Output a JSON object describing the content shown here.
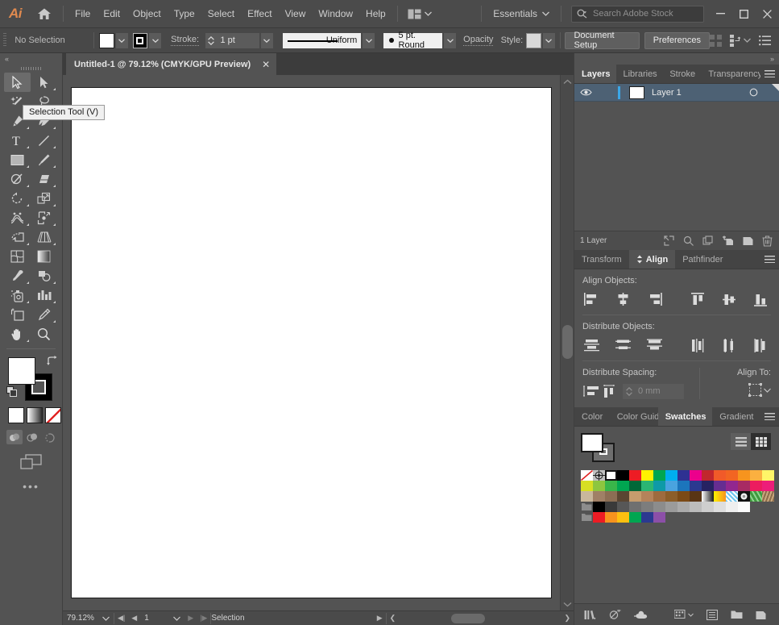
{
  "app": {
    "name": "Adobe Illustrator",
    "logo_text": "Ai"
  },
  "menubar": {
    "home_icon": "home-icon",
    "items": [
      "File",
      "Edit",
      "Object",
      "Type",
      "Select",
      "Effect",
      "View",
      "Window",
      "Help"
    ],
    "arrange_icon": "arrange-documents-icon",
    "workspace": "Essentials",
    "search": {
      "placeholder": "Search Adobe Stock",
      "value": "",
      "icon": "search-icon"
    },
    "window_controls": {
      "minimize": "—",
      "maximize": "❑",
      "close": "✕"
    }
  },
  "controlbar": {
    "selection_status": "No Selection",
    "fill_label": "fill-swatch",
    "stroke_swatch_label": "stroke-swatch",
    "stroke_label": "Stroke:",
    "stroke_weight": "1 pt",
    "stroke_profile": "Uniform",
    "brush": "5 pt. Round",
    "opacity_label": "Opacity",
    "style_label": "Style:",
    "document_setup": "Document Setup",
    "preferences": "Preferences"
  },
  "toolbar": {
    "collapse_icon": "collapse-panel-icon",
    "tools": [
      {
        "name": "selection-tool",
        "active": true,
        "flyout": false
      },
      {
        "name": "direct-selection-tool",
        "active": false,
        "flyout": true
      },
      {
        "name": "magic-wand-tool",
        "active": false,
        "flyout": true
      },
      {
        "name": "lasso-tool",
        "active": false,
        "flyout": false
      },
      {
        "name": "pen-tool",
        "active": false,
        "flyout": true
      },
      {
        "name": "curvature-tool",
        "active": false,
        "flyout": true
      },
      {
        "name": "type-tool",
        "active": false,
        "flyout": true
      },
      {
        "name": "line-segment-tool",
        "active": false,
        "flyout": true
      },
      {
        "name": "rectangle-tool",
        "active": false,
        "flyout": true
      },
      {
        "name": "paintbrush-tool",
        "active": false,
        "flyout": true
      },
      {
        "name": "shaper-tool",
        "active": false,
        "flyout": true
      },
      {
        "name": "eraser-tool",
        "active": false,
        "flyout": true
      },
      {
        "name": "rotate-tool",
        "active": false,
        "flyout": true
      },
      {
        "name": "scale-tool",
        "active": false,
        "flyout": true
      },
      {
        "name": "width-tool",
        "active": false,
        "flyout": true
      },
      {
        "name": "free-transform-tool",
        "active": false,
        "flyout": true
      },
      {
        "name": "shape-builder-tool",
        "active": false,
        "flyout": true
      },
      {
        "name": "perspective-grid-tool",
        "active": false,
        "flyout": true
      },
      {
        "name": "mesh-tool",
        "active": false,
        "flyout": false
      },
      {
        "name": "gradient-tool",
        "active": false,
        "flyout": false
      },
      {
        "name": "eyedropper-tool",
        "active": false,
        "flyout": true
      },
      {
        "name": "blend-tool",
        "active": false,
        "flyout": true
      },
      {
        "name": "symbol-sprayer-tool",
        "active": false,
        "flyout": true
      },
      {
        "name": "column-graph-tool",
        "active": false,
        "flyout": true
      },
      {
        "name": "artboard-tool",
        "active": false,
        "flyout": false
      },
      {
        "name": "slice-tool",
        "active": false,
        "flyout": true
      },
      {
        "name": "hand-tool",
        "active": false,
        "flyout": true
      },
      {
        "name": "zoom-tool",
        "active": false,
        "flyout": false
      }
    ],
    "fill_color": "#ffffff",
    "stroke_color": "#000000",
    "swap_icon": "swap-fill-stroke-icon",
    "default_icon": "default-fill-stroke-icon",
    "color_modes": [
      "color-mode-icon",
      "gradient-mode-icon",
      "none-mode-icon"
    ],
    "draw_modes": [
      "draw-normal-icon",
      "draw-behind-icon",
      "draw-inside-icon"
    ],
    "screen_mode_icon": "change-screen-mode-icon",
    "more_tools_icon": "edit-toolbar-icon"
  },
  "tooltip": {
    "text": "Selection Tool (V)"
  },
  "document": {
    "tab_title": "Untitled-1 @ 79.12% (CMYK/GPU Preview)",
    "close_icon": "close-tab-icon",
    "artboard_color": "#ffffff"
  },
  "statusbar": {
    "zoom": "79.12%",
    "page": "1",
    "tool_status": "Selection",
    "first_icon": "first-page-icon",
    "prev_icon": "prev-page-icon",
    "next_icon": "next-page-icon",
    "last_icon": "last-page-icon"
  },
  "layers_panel": {
    "tabs": [
      "Layers",
      "Libraries",
      "Stroke",
      "Transparency"
    ],
    "active_tab": "Layers",
    "menu_icon": "panel-menu-icon",
    "row": {
      "visibility_icon": "eye-icon",
      "thumbnail_color": "#ffffff",
      "color_marker": "#3ba7e8",
      "name": "Layer 1",
      "target_icon": "target-circle-icon"
    },
    "footer_count": "1 Layer",
    "footer_icons": [
      "locate-object-icon",
      "search-icon",
      "make-clipping-mask-icon",
      "create-sublayer-icon",
      "create-new-layer-icon",
      "delete-selection-icon"
    ]
  },
  "align_panel": {
    "tabs": [
      "Transform",
      "Align",
      "Pathfinder"
    ],
    "active_tab": "Align",
    "menu_icon": "panel-menu-icon",
    "align_objects_label": "Align Objects:",
    "align_icons": [
      "horizontal-align-left-icon",
      "horizontal-align-center-icon",
      "horizontal-align-right-icon",
      "vertical-align-top-icon",
      "vertical-align-center-icon",
      "vertical-align-bottom-icon"
    ],
    "distribute_objects_label": "Distribute Objects:",
    "distribute_icons": [
      "vertical-distribute-top-icon",
      "vertical-distribute-center-icon",
      "vertical-distribute-bottom-icon",
      "horizontal-distribute-left-icon",
      "horizontal-distribute-center-icon",
      "horizontal-distribute-right-icon"
    ],
    "distribute_spacing_label": "Distribute Spacing:",
    "spacing_icons": [
      "vertical-distribute-space-icon",
      "horizontal-distribute-space-icon"
    ],
    "spacing_value": "0 mm",
    "align_to_label": "Align To:",
    "align_to_icon": "align-to-selection-icon"
  },
  "swatches_panel": {
    "tabs": [
      "Color",
      "Color Guide",
      "Swatches",
      "Gradient"
    ],
    "active_tab": "Swatches",
    "menu_icon": "panel-menu-icon",
    "fill_color": "#ffffff",
    "stroke_color": "#6e6e6e",
    "view_list_icon": "list-view-icon",
    "view_grid_icon": "grid-view-icon",
    "active_view": "grid",
    "grid_rows": [
      [
        "none",
        "registration",
        "#ffffff",
        "#000000",
        "#ed1c24",
        "#fff200",
        "#00a651",
        "#00aeef",
        "#2e3192",
        "#ec008c",
        "#c1272d",
        "#f15a29",
        "#f26522",
        "#f7941e",
        "#fbb040",
        "#fff568"
      ],
      [
        "#d7df23",
        "#8dc63f",
        "#39b54a",
        "#00a651",
        "#006838",
        "#2bb673",
        "#0e9aa7",
        "#4aa3df",
        "#1c75bc",
        "#2b3990",
        "#262262",
        "#662d91",
        "#92278f",
        "#a82b63",
        "#ec1c5f",
        "#ed1e79"
      ],
      [
        "#c9b79c",
        "#a08066",
        "#8c6e54",
        "#5a4632",
        "#c69c6d",
        "#b5835a",
        "#9e6b3f",
        "#8c5e2a",
        "#7b4a16",
        "#593515",
        "gradient-white",
        "gradient-orange",
        "pattern-blue",
        "pattern-dots",
        "pattern-leaf",
        "pattern-bark"
      ],
      [
        "folder",
        "#000000",
        "#3a3a3a",
        "#575757",
        "#707070",
        "#7d7d7d",
        "#8c8c8c",
        "#9b9b9b",
        "#ababab",
        "#bcbcbc",
        "#cecece",
        "#dedede",
        "#efefef",
        "#fbfbfb"
      ],
      [
        "folder",
        "#ed1c24",
        "#f7931e",
        "#fdc010",
        "#00a651",
        "#2b3990",
        "#8c4fa8"
      ]
    ],
    "footer_icons": [
      "swatch-libraries-icon",
      "show-swatch-kinds-icon",
      "add-to-library-icon",
      "new-color-group-icon",
      "swatch-options-icon",
      "new-folder-icon",
      "new-swatch-icon",
      "delete-swatch-icon"
    ]
  }
}
